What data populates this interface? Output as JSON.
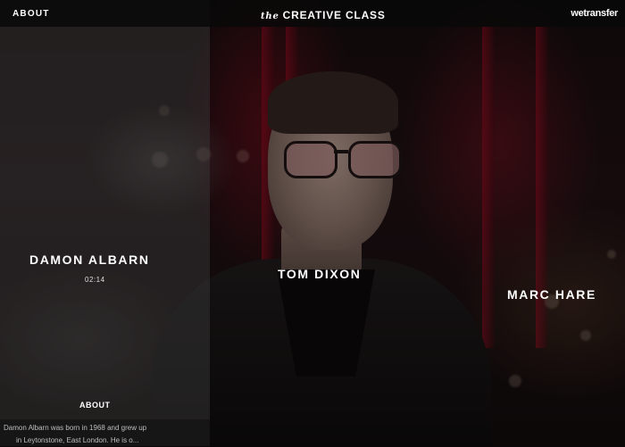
{
  "header": {
    "about_label": "ABOUT",
    "brand_prefix": "the",
    "brand_name": "CREATIVE CLASS",
    "partner_logo": "wetransfer"
  },
  "people": [
    {
      "name": "DAMON ALBARN",
      "duration": "02:14"
    },
    {
      "name": "TOM DIXON"
    },
    {
      "name": "MARC HARE"
    }
  ],
  "about_section": {
    "label": "ABOUT",
    "bio_line1": "Damon Albarn was born in 1968 and grew up",
    "bio_line2": "in Leytonstone, East London. He is o..."
  },
  "colors": {
    "top_bar": "#080808",
    "curtain_red": "#8c0a1e",
    "text": "#ffffff"
  }
}
